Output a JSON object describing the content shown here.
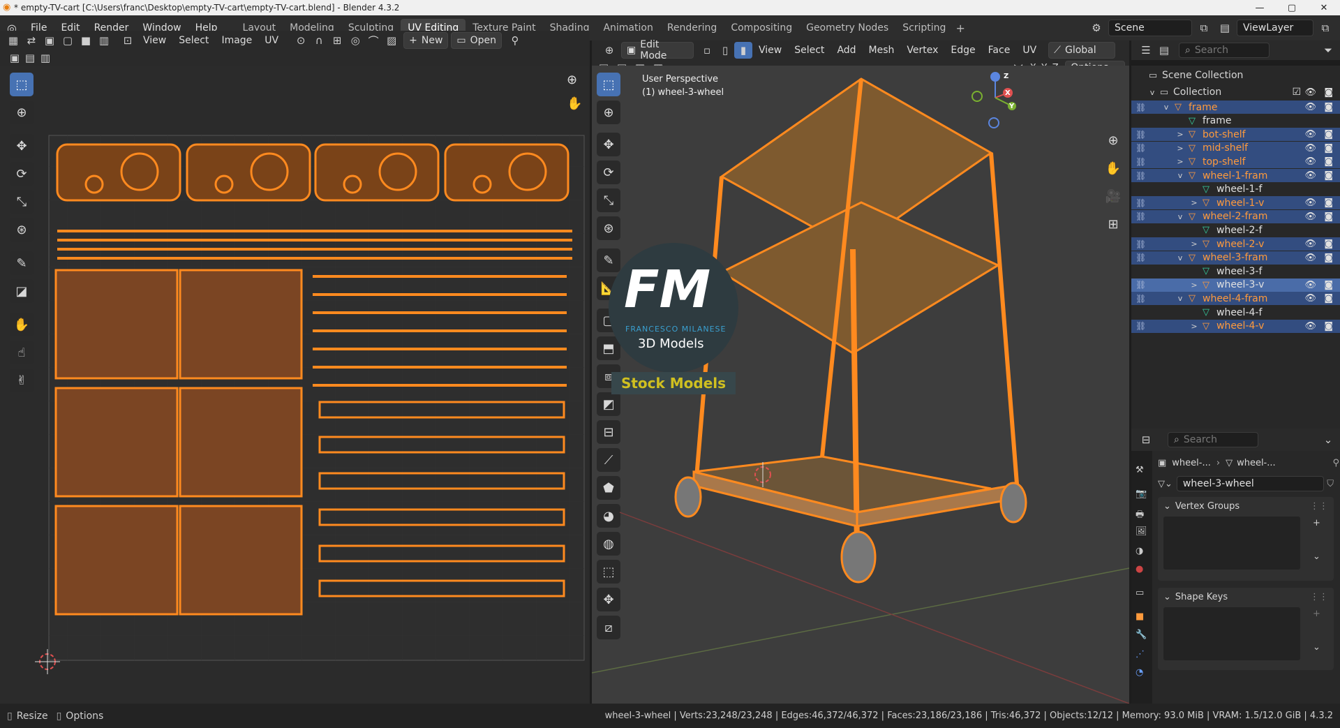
{
  "window": {
    "title": "* empty-TV-cart [C:\\Users\\franc\\Desktop\\empty-TV-cart\\empty-TV-cart.blend] - Blender 4.3.2",
    "min": "—",
    "max": "▢",
    "close": "✕"
  },
  "menu": [
    "File",
    "Edit",
    "Render",
    "Window",
    "Help"
  ],
  "workspaces": [
    {
      "label": "Layout",
      "active": false
    },
    {
      "label": "Modeling",
      "active": false
    },
    {
      "label": "Sculpting",
      "active": false
    },
    {
      "label": "UV Editing",
      "active": true
    },
    {
      "label": "Texture Paint",
      "active": false
    },
    {
      "label": "Shading",
      "active": false
    },
    {
      "label": "Animation",
      "active": false
    },
    {
      "label": "Rendering",
      "active": false
    },
    {
      "label": "Compositing",
      "active": false
    },
    {
      "label": "Geometry Nodes",
      "active": false
    },
    {
      "label": "Scripting",
      "active": false
    }
  ],
  "add_workspace": "+",
  "scene": {
    "label": "Scene",
    "viewlayer": "ViewLayer"
  },
  "uv_header": {
    "menus": [
      "View",
      "Select",
      "Image",
      "UV"
    ],
    "new_label": "New",
    "open_label": "Open"
  },
  "vp_header": {
    "mode": "Edit Mode",
    "menus": [
      "View",
      "Select",
      "Add",
      "Mesh",
      "Vertex",
      "Edge",
      "Face",
      "UV"
    ],
    "orientation": "Global",
    "options": "Options",
    "axes": [
      "X",
      "Y",
      "Z"
    ]
  },
  "viewport": {
    "perspective": "User Perspective",
    "object": "(1) wheel-3-wheel"
  },
  "watermark": {
    "big": "FM",
    "name": "FRANCESCO MILANESE",
    "sub": "3D Models",
    "stock": "Stock Models"
  },
  "gizmo": {
    "z": "Z",
    "x": "X",
    "y": "Y"
  },
  "outliner": {
    "search_placeholder": "Search",
    "scene_collection": "Scene Collection",
    "collection": "Collection",
    "rows": [
      {
        "label": "frame",
        "indent": 1,
        "sel": true,
        "color": "orange",
        "tri": "v",
        "icon": "object"
      },
      {
        "label": "frame",
        "indent": 2,
        "sel": false,
        "color": "white",
        "tri": "",
        "icon": "mesh"
      },
      {
        "label": "bot-shelf",
        "indent": 2,
        "sel": true,
        "color": "orange",
        "tri": ">",
        "icon": "object"
      },
      {
        "label": "mid-shelf",
        "indent": 2,
        "sel": true,
        "color": "orange",
        "tri": ">",
        "icon": "object"
      },
      {
        "label": "top-shelf",
        "indent": 2,
        "sel": true,
        "color": "orange",
        "tri": ">",
        "icon": "object"
      },
      {
        "label": "wheel-1-fram",
        "indent": 2,
        "sel": true,
        "color": "orange",
        "tri": "v",
        "icon": "object"
      },
      {
        "label": "wheel-1-f",
        "indent": 3,
        "sel": false,
        "color": "white",
        "tri": "",
        "icon": "mesh"
      },
      {
        "label": "wheel-1-v",
        "indent": 3,
        "sel": true,
        "color": "orange",
        "tri": ">",
        "icon": "object"
      },
      {
        "label": "wheel-2-fram",
        "indent": 2,
        "sel": true,
        "color": "orange",
        "tri": "v",
        "icon": "object"
      },
      {
        "label": "wheel-2-f",
        "indent": 3,
        "sel": false,
        "color": "white",
        "tri": "",
        "icon": "mesh"
      },
      {
        "label": "wheel-2-v",
        "indent": 3,
        "sel": true,
        "color": "orange",
        "tri": ">",
        "icon": "object"
      },
      {
        "label": "wheel-3-fram",
        "indent": 2,
        "sel": true,
        "color": "orange",
        "tri": "v",
        "icon": "object"
      },
      {
        "label": "wheel-3-f",
        "indent": 3,
        "sel": false,
        "color": "white",
        "tri": "",
        "icon": "mesh"
      },
      {
        "label": "wheel-3-v",
        "indent": 3,
        "sel": true,
        "color": "white",
        "tri": ">",
        "icon": "object",
        "active": true
      },
      {
        "label": "wheel-4-fram",
        "indent": 2,
        "sel": true,
        "color": "orange",
        "tri": "v",
        "icon": "object"
      },
      {
        "label": "wheel-4-f",
        "indent": 3,
        "sel": false,
        "color": "white",
        "tri": "",
        "icon": "mesh"
      },
      {
        "label": "wheel-4-v",
        "indent": 3,
        "sel": true,
        "color": "orange",
        "tri": ">",
        "icon": "object"
      }
    ]
  },
  "properties": {
    "search_placeholder": "Search",
    "breadcrumb_a": "wheel-...",
    "breadcrumb_b": "wheel-...",
    "mesh_name": "wheel-3-wheel",
    "vertex_groups": "Vertex Groups",
    "shape_keys": "Shape Keys"
  },
  "status": {
    "resize": "Resize",
    "options": "Options",
    "stats": "wheel-3-wheel | Verts:23,248/23,248 | Edges:46,372/46,372 | Faces:23,186/23,186 | Tris:46,372 | Objects:12/12 | Memory: 93.0 MiB | VRAM: 1.5/12.0 GiB | 4.3.2"
  },
  "colors": {
    "accent": "#4772b3",
    "uv_orange": "#ff8a1f",
    "selection": "#334d80"
  }
}
